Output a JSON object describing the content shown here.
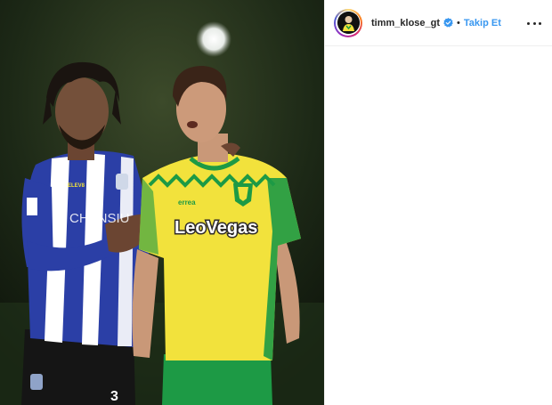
{
  "post": {
    "image_alt": "Two football players on the pitch",
    "shirt_sponsor": "LeoVegas",
    "shirt_maker": "errea",
    "away_shirt_sponsor": "CHANSIU",
    "away_shirt_sleeve": "ELEV8",
    "away_number": "3"
  },
  "header": {
    "username": "timm_klose_gt",
    "verified": true,
    "separator": "•",
    "follow_label": "Takip Et",
    "more_icon": "more-horizontal-icon"
  },
  "colors": {
    "follow": "#3897f0",
    "verified": "#3897f0",
    "norwich_yellow": "#f2e23c",
    "norwich_green": "#1d9a45",
    "wednesday_blue": "#2a3ea8"
  }
}
